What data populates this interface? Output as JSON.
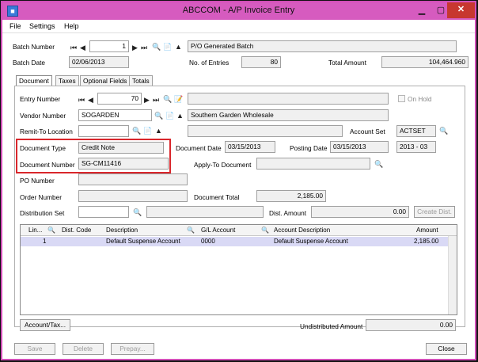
{
  "window": {
    "title": "ABCCOM - A/P Invoice Entry"
  },
  "icons": {
    "app": "app-icon",
    "minimize": "minimize-icon",
    "maximize": "maximize-icon",
    "close": "close-icon"
  },
  "menu": {
    "file": "File",
    "settings": "Settings",
    "help": "Help"
  },
  "header": {
    "batch_number_label": "Batch Number",
    "batch_number": "1",
    "batch_description": "P/O Generated Batch",
    "batch_date_label": "Batch Date",
    "batch_date": "02/06/2013",
    "entries_label": "No. of Entries",
    "entries": "80",
    "total_amount_label": "Total Amount",
    "total_amount": "104,464.960"
  },
  "tabs": [
    "Document",
    "Taxes",
    "Optional Fields",
    "Totals"
  ],
  "document": {
    "entry_number_label": "Entry Number",
    "entry_number": "70",
    "on_hold_label": "On Hold",
    "vendor_number_label": "Vendor Number",
    "vendor_number": "SOGARDEN",
    "vendor_name": "Southern Garden Wholesale",
    "remit_to_label": "Remit-To Location",
    "account_set_label": "Account Set",
    "account_set": "ACTSET",
    "document_type_label": "Document Type",
    "document_type": "Credit Note",
    "document_date_label": "Document Date",
    "document_date": "03/15/2013",
    "posting_date_label": "Posting Date",
    "posting_date": "03/15/2013",
    "fiscal_period": "2013 - 03",
    "document_number_label": "Document Number",
    "document_number": "SG-CM11416",
    "apply_to_label": "Apply-To Document",
    "po_number_label": "PO Number",
    "order_number_label": "Order Number",
    "document_total_label": "Document Total",
    "document_total": "2,185.00",
    "distribution_set_label": "Distribution Set",
    "dist_amount_label": "Dist. Amount",
    "dist_amount": "0.00",
    "create_dist_label": "Create Dist."
  },
  "grid": {
    "columns": [
      "Lin...",
      "Dist. Code",
      "Description",
      "G/L Account",
      "Account Description",
      "Amount"
    ],
    "rows": [
      {
        "line": "1",
        "dist_code": "",
        "description": "Default Suspense Account",
        "gl_account": "0000",
        "account_description": "Default Suspense Account",
        "amount": "2,185.00"
      }
    ]
  },
  "footer": {
    "account_tax_label": "Account/Tax...",
    "undistributed_label": "Undistributed Amount",
    "undistributed": "0.00",
    "save_label": "Save",
    "delete_label": "Delete",
    "prepay_label": "Prepay...",
    "close_label": "Close"
  }
}
